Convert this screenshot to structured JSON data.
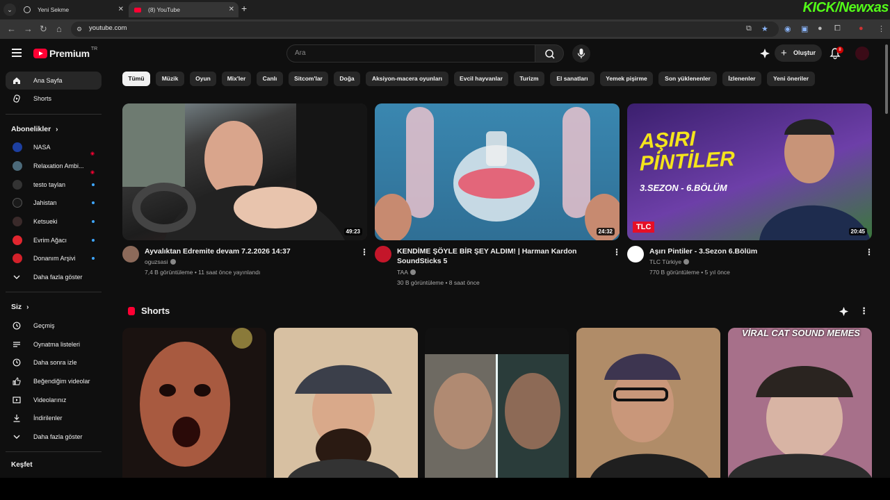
{
  "browser": {
    "tabs": [
      {
        "label": "Yeni Sekme"
      },
      {
        "label": "(8) YouTube"
      }
    ],
    "url": "youtube.com",
    "overlay_logo": "KICK/Newxas"
  },
  "header": {
    "logo_text": "Premium",
    "country_code": "TR",
    "search_placeholder": "Ara",
    "create_label": "Oluştur",
    "notification_count": "8"
  },
  "sidebar": {
    "main": [
      {
        "label": "Ana Sayfa"
      },
      {
        "label": "Shorts"
      }
    ],
    "subscriptions_heading": "Abonelikler",
    "subscriptions": [
      {
        "label": "NASA",
        "status": "live",
        "color": "#1d3fa0"
      },
      {
        "label": "Relaxation Ambi...",
        "status": "live",
        "color": "#4c6a7a"
      },
      {
        "label": "testo taylan",
        "status": "new",
        "color": "#333333"
      },
      {
        "label": "Jahistan",
        "status": "new",
        "color": "#1a1a1a"
      },
      {
        "label": "Ketsueki",
        "status": "new",
        "color": "#3a2a2a"
      },
      {
        "label": "Evrim Ağacı",
        "status": "new",
        "color": "#e2262f"
      },
      {
        "label": "Donanım Arşivi",
        "status": "new",
        "color": "#d4212a"
      }
    ],
    "subscriptions_more": "Daha fazla göster",
    "you_heading": "Siz",
    "you": [
      {
        "label": "Geçmiş"
      },
      {
        "label": "Oynatma listeleri"
      },
      {
        "label": "Daha sonra izle"
      },
      {
        "label": "Beğendiğim videolar"
      },
      {
        "label": "Videolarınız"
      },
      {
        "label": "İndirilenler"
      }
    ],
    "you_more": "Daha fazla göster",
    "explore_heading": "Keşfet"
  },
  "chips": [
    "Tümü",
    "Müzik",
    "Oyun",
    "Mix'ler",
    "Canlı",
    "Sitcom'lar",
    "Doğa",
    "Aksiyon-macera oyunları",
    "Evcil hayvanlar",
    "Turizm",
    "El sanatları",
    "Yemek pişirme",
    "Son yüklenenler",
    "İzlenenler",
    "Yeni öneriler"
  ],
  "videos": [
    {
      "title": "Ayvalıktan Edremite devam 7.2.2026 14:37",
      "channel": "oguzsasi",
      "meta": "7,4 B görüntüleme • 11 saat önce yayınlandı",
      "duration": "49:23"
    },
    {
      "title": "KENDİME ŞÖYLE BİR ŞEY ALDIM! | Harman Kardon SoundSticks 5",
      "channel": "TAA",
      "meta": "30 B görüntüleme • 8 saat önce",
      "duration": "24:32"
    },
    {
      "title": "Aşırı Pintiler - 3.Sezon 6.Bölüm",
      "channel": "TLC Türkiye",
      "meta": "770 B görüntüleme • 5 yıl önce",
      "duration": "20:45",
      "thumb_title": "AŞIRI PİNTİLER",
      "thumb_subtitle": "3.SEZON - 6.BÖLÜM",
      "thumb_badge": "TLC"
    }
  ],
  "shorts": {
    "heading": "Shorts",
    "items": [
      {
        "caption": ""
      },
      {
        "caption": ""
      },
      {
        "caption": ""
      },
      {
        "caption": ""
      },
      {
        "caption": "VİRAL CAT SOUND MEMES"
      }
    ]
  }
}
